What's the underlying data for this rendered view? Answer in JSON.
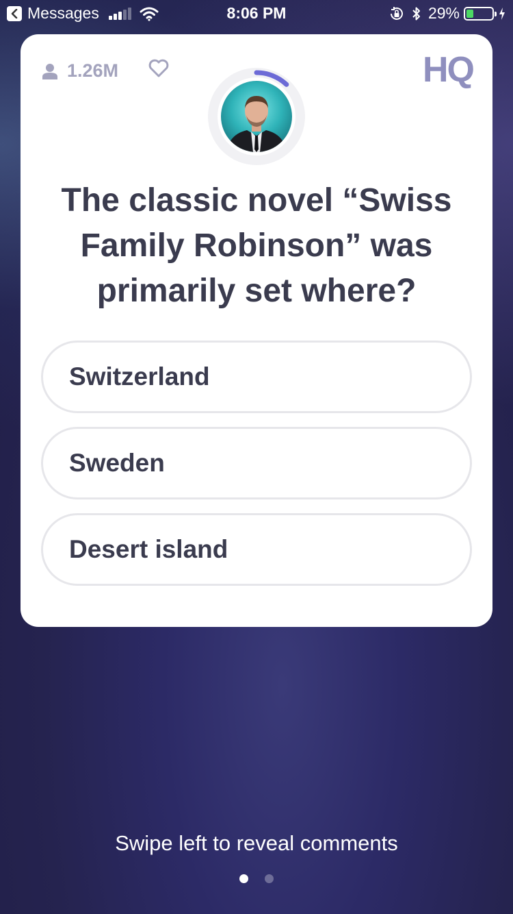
{
  "status_bar": {
    "back_app": "Messages",
    "time": "8:06 PM",
    "battery": "29%",
    "battery_level": 0.29
  },
  "card": {
    "player_count": "1.26M",
    "logo": "HQ",
    "question": "The classic novel “Swiss Family Robinson” was primarily set where?",
    "answers": [
      "Switzerland",
      "Sweden",
      "Desert island"
    ],
    "timer_progress": 0.12,
    "colors": {
      "accent": "#6c6ad6",
      "muted": "#a3a3bd",
      "text": "#3a3b4e"
    },
    "icons": [
      "user-icon",
      "heart-icon"
    ]
  },
  "footer": {
    "swipe_hint": "Swipe left to reveal comments",
    "pages": 2,
    "active_page": 1
  }
}
